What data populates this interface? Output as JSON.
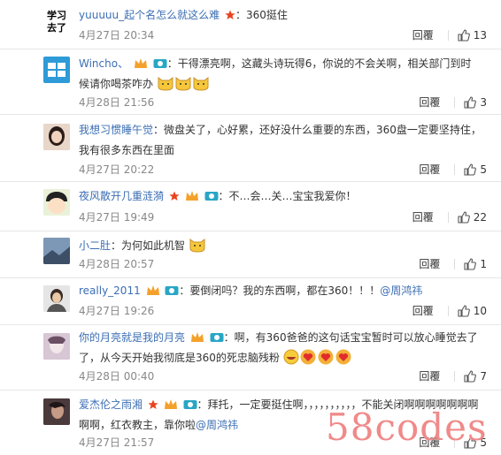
{
  "comments": [
    {
      "avatar_text": "学习\n去了",
      "user": "yuuuuu_起个名怎么就这么难",
      "text": "：360挺住",
      "date": "4月27日 20:34",
      "reply": "回覆",
      "likes": "13"
    },
    {
      "user": "Wincho、",
      "text": "：干得漂亮啊，这藏头诗玩得6，你说的不会关啊，相关部门到时候请你喝茶咋办",
      "date": "4月28日 21:56",
      "reply": "回覆",
      "likes": "3"
    },
    {
      "user": "我想习惯睡午觉",
      "text": "：微盘关了，心好累，还好没什么重要的东西，360盘一定要坚持住，我有很多东西在里面",
      "date": "4月27日 20:22",
      "reply": "回覆",
      "likes": "5"
    },
    {
      "user": "夜风散开几重涟漪",
      "text": "：不…会…关…宝宝我爱你！",
      "date": "4月27日 19:49",
      "reply": "回覆",
      "likes": "22"
    },
    {
      "user": "小二肚",
      "text": "：为何如此机智",
      "date": "4月28日 20:57",
      "reply": "回覆",
      "likes": "1"
    },
    {
      "user": "really_2011",
      "text": "：要倒闭吗？我的东西啊，都在360！！！",
      "mention": "@周鸿祎",
      "date": "4月27日 19:26",
      "reply": "回覆",
      "likes": "10"
    },
    {
      "user": "你的月亮就是我的月亮",
      "text": "：啊，有360爸爸的这句话宝宝暂时可以放心睡觉去了了，从今天开始我彻底是360的死忠脑残粉",
      "date": "4月28日 00:40",
      "reply": "回覆",
      "likes": "7"
    },
    {
      "user": "爱杰伦之雨湘",
      "text": "：拜托，一定要挺住啊，，，，，，，，，，不能关闭啊啊啊啊啊啊啊啊啊，红衣教主，靠你啦",
      "mention": "@周鸿祎",
      "date": "4月27日 21:57",
      "reply": "回覆",
      "likes": "5"
    }
  ],
  "watermark": "58codes"
}
